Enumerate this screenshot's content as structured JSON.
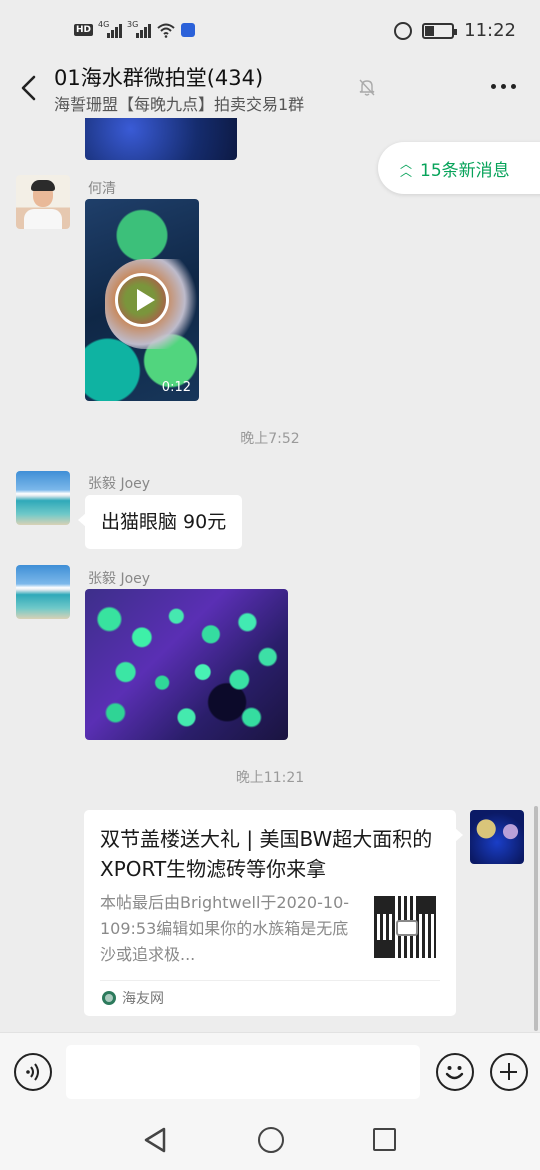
{
  "status_bar": {
    "network_hd": "HD",
    "network_4g": "4G",
    "network_3g": "3G",
    "time": "11:22",
    "icons": [
      "hd-icon",
      "signal-4g-icon",
      "signal-3g-icon",
      "wifi-icon",
      "baidu-icon",
      "alarm-icon",
      "battery-icon"
    ]
  },
  "header": {
    "title": "01海水群微拍堂(434)",
    "subtitle": "海誓珊盟【每晚九点】拍卖交易1群",
    "icons": [
      "back-icon",
      "mute-icon",
      "more-icon"
    ]
  },
  "new_messages": {
    "label": "15条新消息",
    "icon": "double-chevron-up-icon",
    "color": "#07a35a"
  },
  "messages": [
    {
      "sender": "何清",
      "type": "video",
      "duration": "0:12"
    },
    {
      "type": "timestamp",
      "text": "晚上7:52"
    },
    {
      "sender": "张毅 Joey",
      "type": "text",
      "text": "出猫眼脑 90元"
    },
    {
      "sender": "张毅 Joey",
      "type": "image"
    },
    {
      "type": "timestamp",
      "text": "晚上11:21"
    },
    {
      "sender": "me",
      "type": "link_card",
      "title": "双节盖楼送大礼 | 美国BW超大面积的XPORT生物滤砖等你来拿",
      "description": "本帖最后由Brightwell于2020-10-109:53编辑如果你的水族箱是无底沙或追求极...",
      "source": "海友网"
    }
  ],
  "input_bar": {
    "placeholder": "",
    "icons": [
      "voice-icon",
      "emoji-icon",
      "plus-icon"
    ]
  },
  "system_nav": {
    "icons": [
      "nav-back-icon",
      "nav-home-icon",
      "nav-recents-icon"
    ]
  },
  "colors": {
    "background": "#ededed",
    "accent_green": "#07a35a",
    "bubble": "#ffffff"
  }
}
